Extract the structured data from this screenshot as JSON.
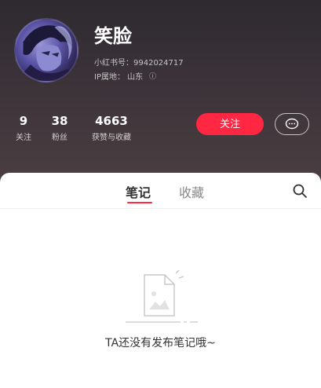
{
  "profile": {
    "name": "笑脸",
    "id_line": "小红书号：9942024717",
    "ip_line": "IP属地：  山东",
    "info_icon": "ⓘ"
  },
  "stats": [
    {
      "value": "9",
      "label": "关注"
    },
    {
      "value": "38",
      "label": "粉丝"
    },
    {
      "value": "4663",
      "label": "获赞与收藏"
    }
  ],
  "actions": {
    "follow_label": "关注",
    "message_icon": "chat-bubble-icon"
  },
  "tabs": [
    {
      "label": "笔记",
      "active": true
    },
    {
      "label": "收藏",
      "active": false
    }
  ],
  "empty_state": {
    "text": "TA还没有发布笔记哦~"
  },
  "colors": {
    "accent": "#ff2741"
  }
}
